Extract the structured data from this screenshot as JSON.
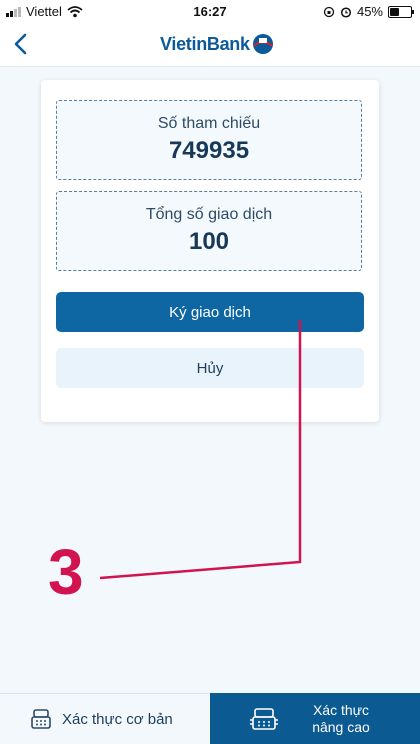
{
  "status_bar": {
    "carrier": "Viettel",
    "time": "16:27",
    "battery": "45%",
    "battery_level": 0.45
  },
  "header": {
    "logo_text": "VietinBank"
  },
  "card": {
    "reference": {
      "label": "Số tham chiếu",
      "value": "749935"
    },
    "total": {
      "label": "Tổng số giao dịch",
      "value": "100"
    },
    "sign_button": "Ký giao dịch",
    "cancel_button": "Hủy"
  },
  "annotation": {
    "number": "3",
    "color": "#d1144f"
  },
  "tabs": {
    "basic": {
      "label": "Xác thực cơ bản"
    },
    "advanced": {
      "line1": "Xác thực",
      "line2": "nâng cao"
    }
  },
  "colors": {
    "primary": "#0e67a3",
    "brand": "#0b5a9a",
    "tab_active_bg": "#0b5a92"
  }
}
